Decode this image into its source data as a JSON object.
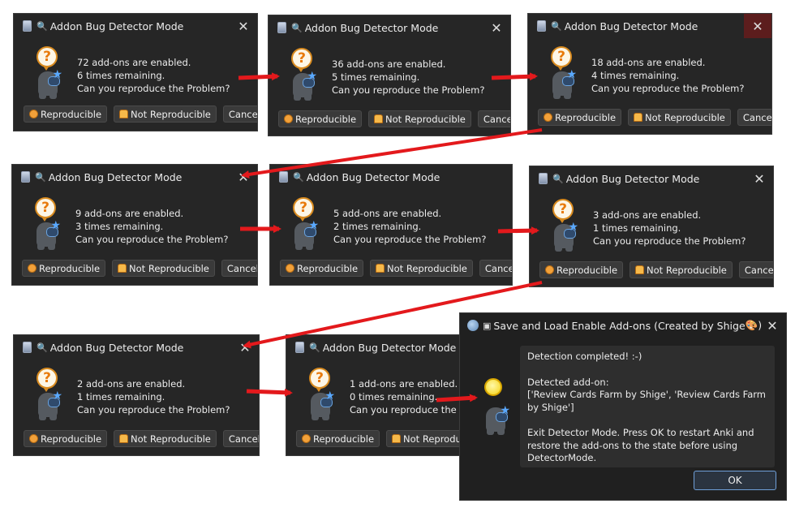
{
  "dialog_title": "Addon Bug Detector Mode",
  "question": "Can you reproduce the Problem?",
  "btn_reproducible": "Reproducible",
  "btn_not_reproducible": "Not Reproducible",
  "btn_cancel": "Cancel",
  "btn_not_reproducible_cut": "Not Reproduc",
  "close_glyph": "✕",
  "steps": [
    {
      "enabled": "72 add-ons are enabled.",
      "remaining": "6 times remaining."
    },
    {
      "enabled": "36 add-ons are enabled.",
      "remaining": "5 times remaining."
    },
    {
      "enabled": "18 add-ons are enabled.",
      "remaining": "4 times remaining."
    },
    {
      "enabled": "9 add-ons are enabled.",
      "remaining": "3 times remaining."
    },
    {
      "enabled": "5 add-ons are enabled.",
      "remaining": "2 times remaining."
    },
    {
      "enabled": "3 add-ons are enabled.",
      "remaining": "1 times remaining."
    },
    {
      "enabled": "2 add-ons are enabled.",
      "remaining": "1 times remaining."
    },
    {
      "enabled": "1 add-ons are enabled.",
      "remaining": "0 times remaining."
    }
  ],
  "final": {
    "title": "Save and Load Enable Add-ons (Created by Shige",
    "title_icon": "🎨)",
    "line1": "Detection completed! :-)",
    "line2": "Detected add-on:",
    "line3": "['Review Cards Farm by Shige', 'Review Cards Farm by Shige']",
    "line4": "Exit Detector Mode. Press OK to restart Anki and restore the add-ons to the state before using DetectorMode.",
    "ok": "OK"
  },
  "icons": {
    "window_icon": "app-window-icon",
    "search": "magnifier-icon",
    "question": "question-bubble-icon",
    "mascot": "mascot-icon",
    "bulb": "lightbulb-icon",
    "arrow_color": "#e3191c"
  }
}
